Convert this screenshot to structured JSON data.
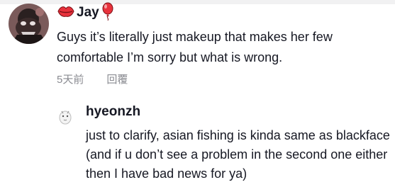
{
  "comment": {
    "username": "Jay",
    "text": "Guys it’s literally just makeup that makes her few comfortable I’m sorry but what is wrong.",
    "time": "5天前",
    "reply_label": "回覆"
  },
  "reply": {
    "username": "hyeonzh",
    "text": "just to clarify, asian fishing is kinda same as blackface (and if u don’t see a problem in the second one either then I have bad news for ya)"
  },
  "colors": {
    "text": "#161823",
    "meta": "#8a8b91",
    "emoji_red": "#e8323c"
  },
  "icons": {
    "before_name": "lips-icon",
    "after_name": "balloon-icon"
  }
}
